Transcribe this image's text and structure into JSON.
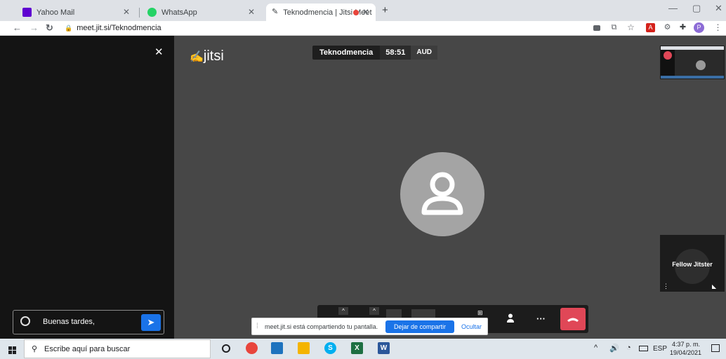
{
  "browser": {
    "tabs": [
      {
        "title": "Yahoo Mail"
      },
      {
        "title": "WhatsApp"
      },
      {
        "title": "Teknodmencia | Jitsi Meet"
      }
    ],
    "new_tab": "+",
    "url": "meet.jit.si/Teknodmencia",
    "profile_initial": "P",
    "window_controls": {
      "minimize": "—",
      "maximize": "▢",
      "close": "✕"
    }
  },
  "chat": {
    "close_icon": "✕",
    "input_value": "Buenas tardes,"
  },
  "meeting": {
    "logo": "jitsi",
    "room_name": "Teknodmencia",
    "timer": "58:51",
    "audio_badge": "AUD",
    "tile_name": "Fellow Jitster",
    "more_label": "···"
  },
  "share_bar": {
    "message": "meet.jit.si está compartiendo tu pantalla.",
    "stop_label": "Dejar de compartir",
    "hide_label": "Ocultar"
  },
  "taskbar": {
    "search_placeholder": "Escribe aquí para buscar",
    "language": "ESP",
    "time": "4:37 p. m.",
    "date": "19/04/2021"
  },
  "colors": {
    "hangup": "#e04757",
    "accent_blue": "#1a73e8",
    "avatar_bg": "#a4a4a4",
    "stage_bg": "#474747"
  }
}
